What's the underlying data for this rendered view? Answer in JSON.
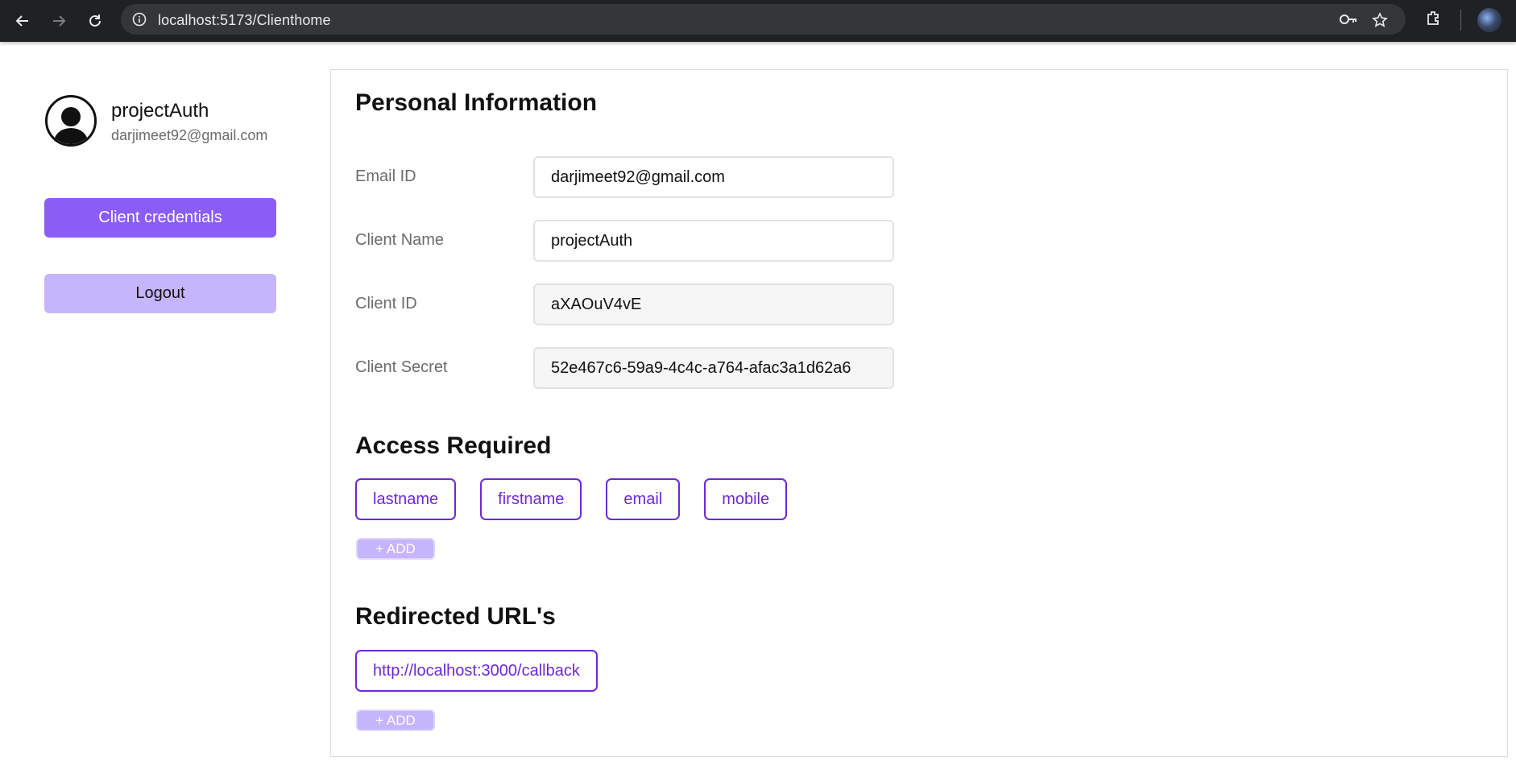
{
  "browser": {
    "url": "localhost:5173/Clienthome"
  },
  "sidebar": {
    "profile_name": "projectAuth",
    "profile_email": "darjimeet92@gmail.com",
    "credentials_button": "Client credentials",
    "logout_button": "Logout"
  },
  "personal_info": {
    "title": "Personal Information",
    "email_label": "Email ID",
    "email_value": "darjimeet92@gmail.com",
    "name_label": "Client Name",
    "name_value": "projectAuth",
    "client_id_label": "Client ID",
    "client_id_value": "aXAOuV4vE",
    "client_secret_label": "Client Secret",
    "client_secret_value": "52e467c6-59a9-4c4c-a764-afac3a1d62a6"
  },
  "access": {
    "title": "Access Required",
    "scopes": [
      "lastname",
      "firstname",
      "email",
      "mobile"
    ],
    "add_label": "+ ADD"
  },
  "redirects": {
    "title": "Redirected URL's",
    "urls": [
      "http://localhost:3000/callback"
    ],
    "add_label": "+ ADD"
  },
  "colors": {
    "accent": "#8b5cf6",
    "accent_light": "#c4b5fd",
    "chip_border": "#6d28d9",
    "chrome_bg": "#202124"
  }
}
